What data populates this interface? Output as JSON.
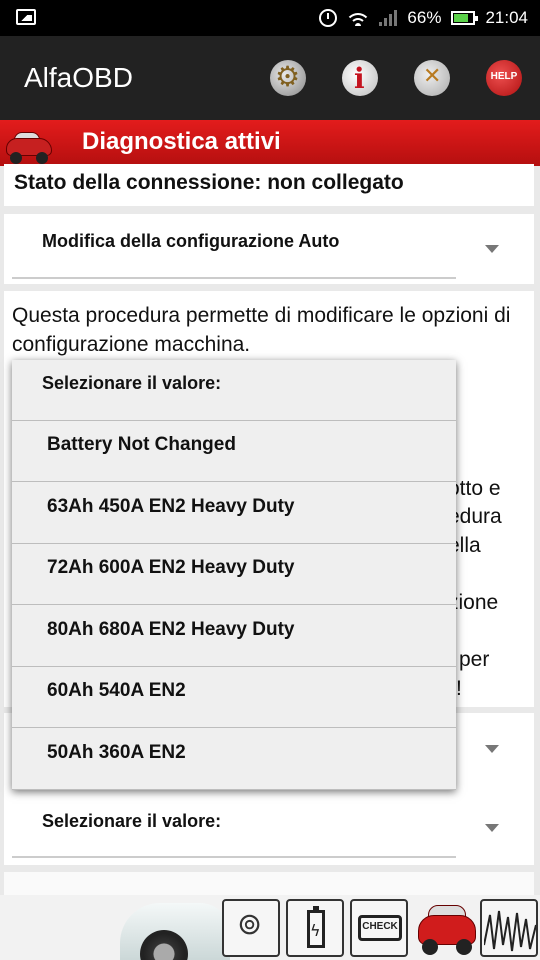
{
  "status_bar": {
    "battery_percent": "66%",
    "time": "21:04"
  },
  "app_bar": {
    "title": "AlfaOBD",
    "help_label": "HELP"
  },
  "header": {
    "title": "Diagnostica attivi"
  },
  "connection": {
    "status": "Stato della connessione: non collegato"
  },
  "procedure_spinner": {
    "selected": "Modifica della configurazione Auto"
  },
  "description": {
    "text": "Questa procedura permette di modificare le opzioni di configurazione macchina.",
    "fragments": [
      "otto e",
      "edura",
      "ella",
      "zione",
      "per",
      "!"
    ]
  },
  "value_spinner": {
    "selected": "Selezionare il valore:"
  },
  "dropdown": {
    "header": "Selezionare il valore:",
    "options": [
      "Battery Not Changed",
      "63Ah 450A EN2 Heavy Duty",
      "72Ah 600A EN2 Heavy Duty",
      "80Ah 680A EN2 Heavy Duty",
      "60Ah 540A EN2",
      "50Ah 360A EN2"
    ]
  },
  "bottom_bar": {
    "check_label": "CHECK"
  },
  "colors": {
    "accent_red": "#d61616",
    "app_bar": "#222222",
    "status_bar": "#000000",
    "battery_green": "#5bd14a"
  },
  "icons": [
    "image-icon",
    "alarm-icon",
    "wifi-icon",
    "signal-icon",
    "battery-icon",
    "gear-icon",
    "info-icon",
    "tools-icon",
    "help-icon",
    "car-icon",
    "key-icon",
    "battery-test-icon",
    "check-engine-icon",
    "waveform-icon"
  ]
}
